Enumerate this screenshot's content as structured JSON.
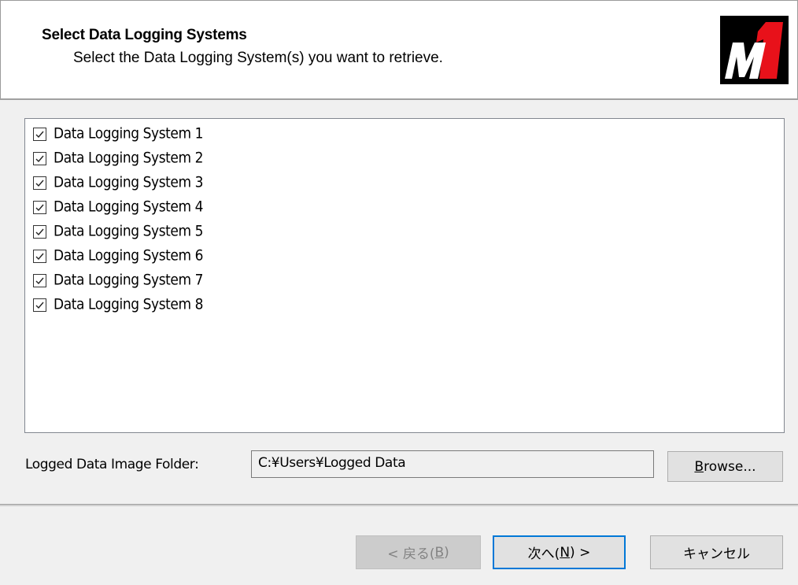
{
  "header": {
    "title": "Select Data Logging Systems",
    "subtitle": "Select the Data Logging System(s) you want to retrieve.",
    "logo": {
      "icon": "m1-logo-icon",
      "text": "M1",
      "colors": {
        "background": "#000000",
        "letter": "#ffffff",
        "accent": "#e8111a"
      }
    }
  },
  "systems": [
    {
      "label": "Data Logging System 1",
      "checked": true
    },
    {
      "label": "Data Logging System 2",
      "checked": true
    },
    {
      "label": "Data Logging System 3",
      "checked": true
    },
    {
      "label": "Data Logging System 4",
      "checked": true
    },
    {
      "label": "Data Logging System 5",
      "checked": true
    },
    {
      "label": "Data Logging System 6",
      "checked": true
    },
    {
      "label": "Data Logging System 7",
      "checked": true
    },
    {
      "label": "Data Logging System 8",
      "checked": true
    }
  ],
  "folder": {
    "label": "Logged Data Image Folder:",
    "value": "C:¥Users¥Logged Data",
    "browse_label_mnemonic": "B",
    "browse_label_rest": "rowse..."
  },
  "footer": {
    "back": {
      "prefix": "< 戻る(",
      "mnemonic": "B",
      "suffix": ")",
      "enabled": false
    },
    "next": {
      "prefix": "次へ(",
      "mnemonic": "N",
      "suffix": ") >"
    },
    "cancel": "キャンセル"
  },
  "colors": {
    "focus_border": "#0078d7",
    "button_face": "#e1e1e1",
    "disabled_face": "#cccccc"
  }
}
